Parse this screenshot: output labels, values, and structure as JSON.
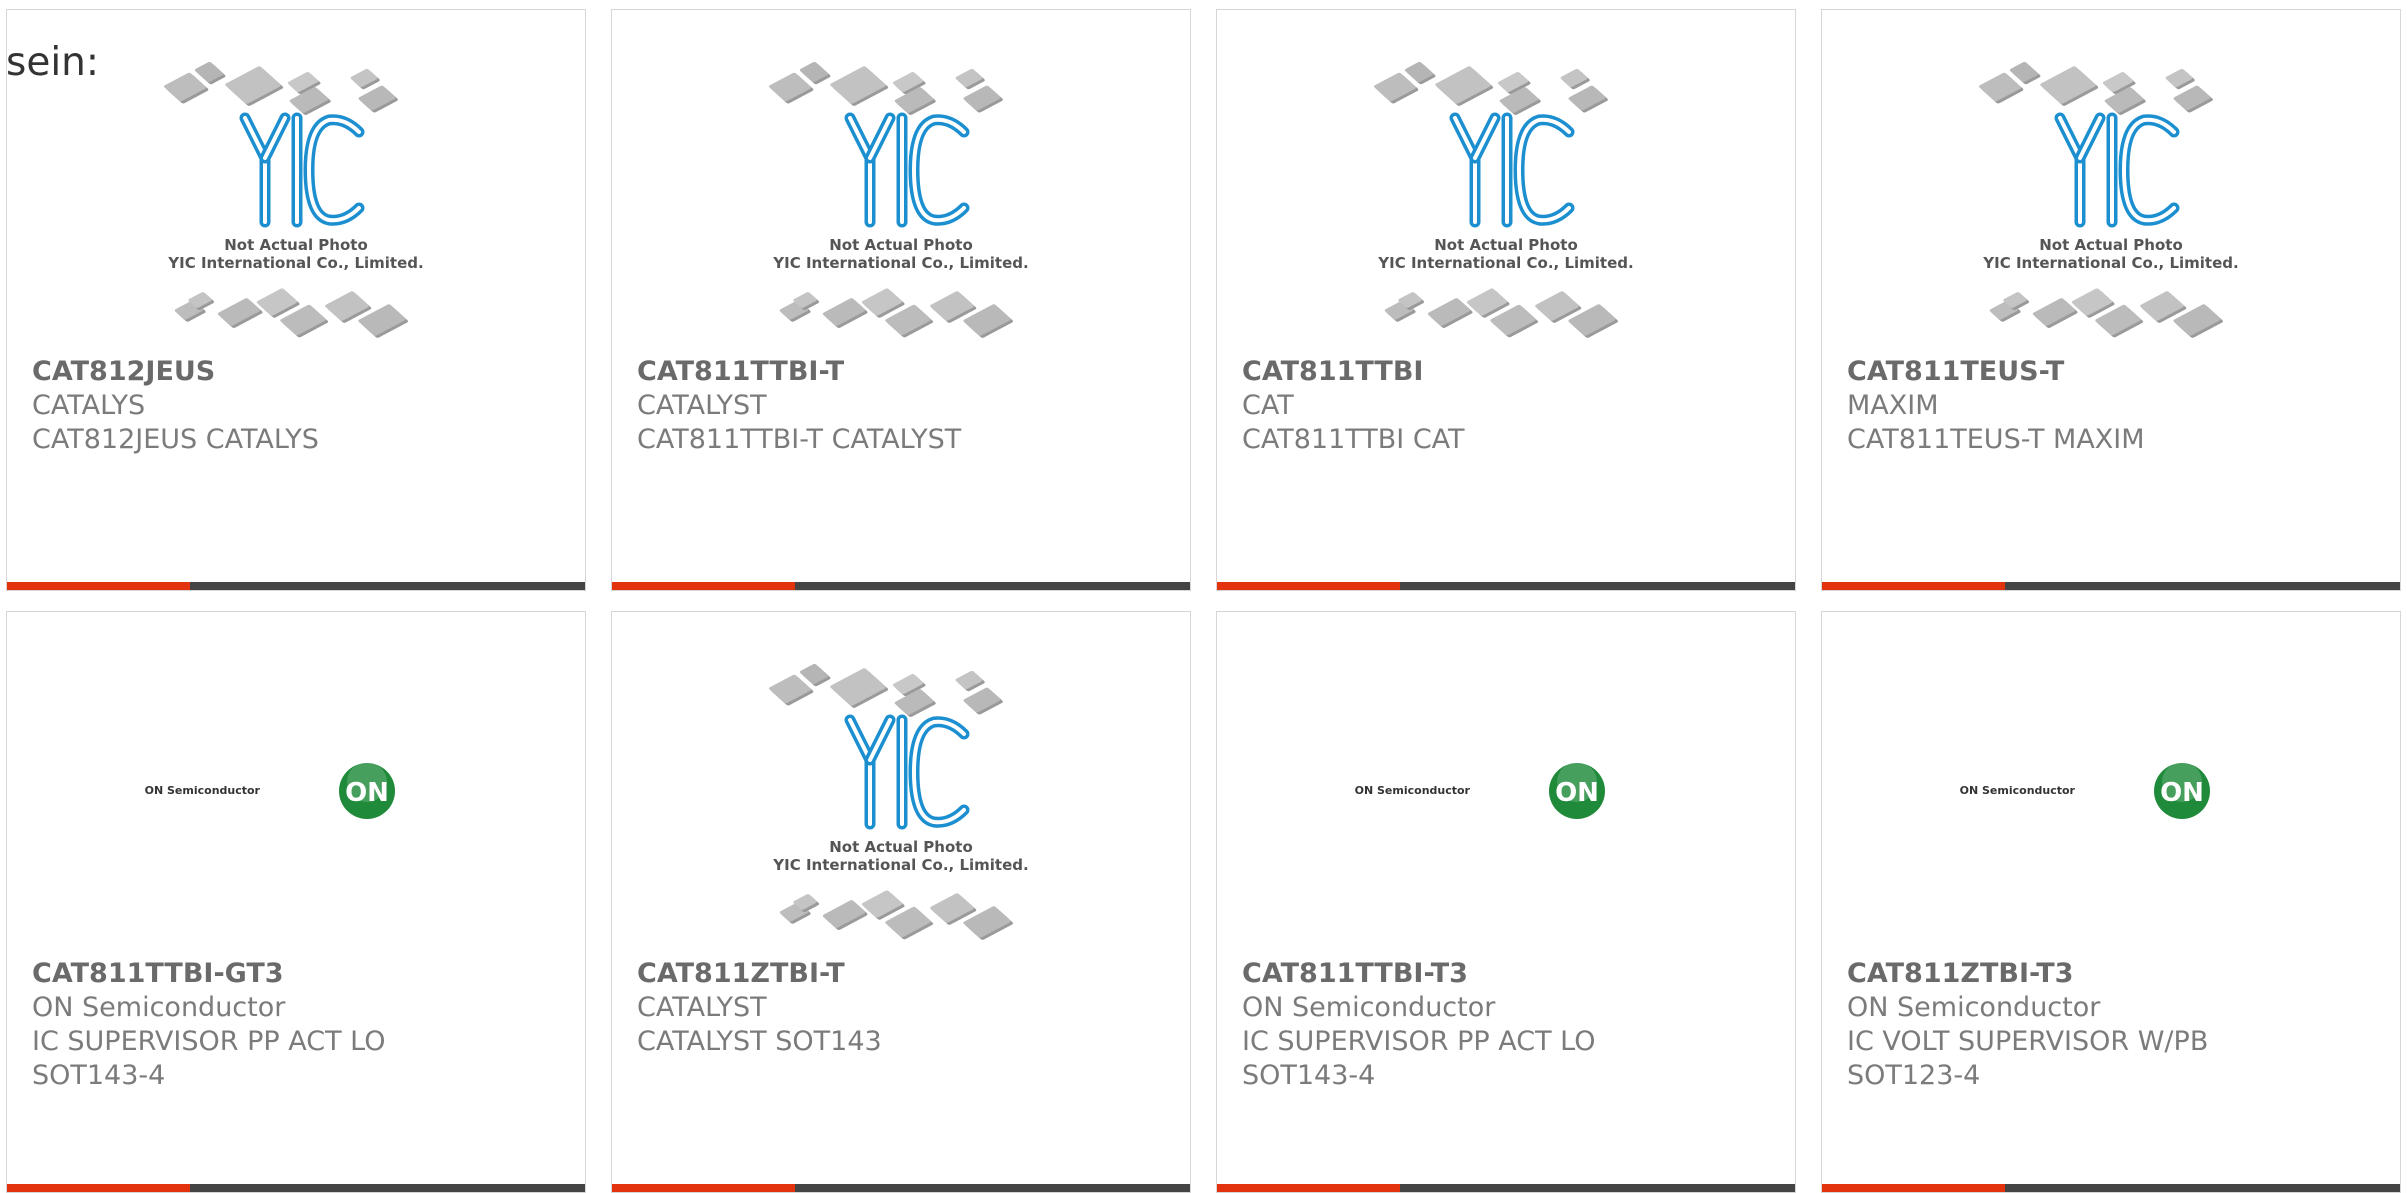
{
  "page_label": "sein:",
  "placeholder_caption": {
    "line1": "Not Actual Photo",
    "line2": "YIC International Co., Limited."
  },
  "onsemi_logo_text": "ON Semiconductor",
  "onsemi_badge_text": "ON",
  "colors": {
    "accent_bar": "#e2330e",
    "bar": "#444444",
    "yic_blue": "#1c8fd0",
    "onsemi_green": "#1f8a3a"
  },
  "products": [
    {
      "part": "CAT812JEUS",
      "maker": "CATALYS",
      "desc": [
        "CAT812JEUS CATALYS"
      ],
      "image": "yic-placeholder"
    },
    {
      "part": "CAT811TTBI-T",
      "maker": "CATALYST",
      "desc": [
        "CAT811TTBI-T CATALYST"
      ],
      "image": "yic-placeholder"
    },
    {
      "part": "CAT811TTBI",
      "maker": "CAT",
      "desc": [
        "CAT811TTBI CAT"
      ],
      "image": "yic-placeholder"
    },
    {
      "part": "CAT811TEUS-T",
      "maker": "MAXIM",
      "desc": [
        "CAT811TEUS-T MAXIM"
      ],
      "image": "yic-placeholder"
    },
    {
      "part": "CAT811TTBI-GT3",
      "maker": "ON Semiconductor",
      "desc": [
        "IC SUPERVISOR PP ACT LO",
        "SOT143-4"
      ],
      "image": "onsemi-logo"
    },
    {
      "part": "CAT811ZTBI-T",
      "maker": "CATALYST",
      "desc": [
        "CATALYST SOT143"
      ],
      "image": "yic-placeholder"
    },
    {
      "part": "CAT811TTBI-T3",
      "maker": "ON Semiconductor",
      "desc": [
        "IC SUPERVISOR PP ACT LO",
        "SOT143-4"
      ],
      "image": "onsemi-logo"
    },
    {
      "part": "CAT811ZTBI-T3",
      "maker": "ON Semiconductor",
      "desc": [
        "IC VOLT SUPERVISOR W/PB",
        "SOT123-4"
      ],
      "image": "onsemi-logo"
    }
  ]
}
